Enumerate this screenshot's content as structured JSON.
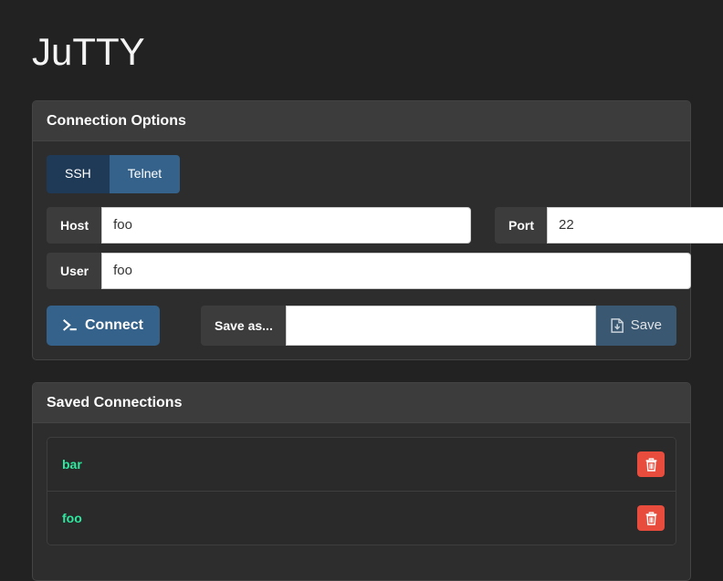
{
  "app": {
    "title": "JuTTY"
  },
  "connection_panel": {
    "heading": "Connection Options",
    "protocols": [
      {
        "label": "SSH",
        "active": false,
        "name": "protocol-ssh"
      },
      {
        "label": "Telnet",
        "active": true,
        "name": "protocol-telnet"
      }
    ],
    "fields": {
      "host": {
        "label": "Host",
        "value": "foo",
        "placeholder": ""
      },
      "port": {
        "label": "Port",
        "value": "22",
        "placeholder": ""
      },
      "user": {
        "label": "User",
        "value": "foo",
        "placeholder": ""
      },
      "save_as": {
        "label": "Save as...",
        "value": "",
        "placeholder": ""
      }
    },
    "connect_button": {
      "label": "Connect",
      "icon": "terminal-prompt-icon"
    },
    "save_button": {
      "label": "Save",
      "icon": "save-file-icon"
    }
  },
  "saved_panel": {
    "heading": "Saved Connections",
    "items": [
      {
        "name": "bar",
        "delete_icon": "trash-icon"
      },
      {
        "name": "foo",
        "delete_icon": "trash-icon"
      }
    ]
  },
  "colors": {
    "page_background": "#222222",
    "panel_background": "#2d2d2d",
    "panel_heading": "#3c3c3c",
    "accent_blue": "#34628a",
    "accent_blue_dark": "#1f3a57",
    "link_green": "#2ee89f",
    "danger_red": "#e74c3c",
    "input_white": "#ffffff"
  }
}
